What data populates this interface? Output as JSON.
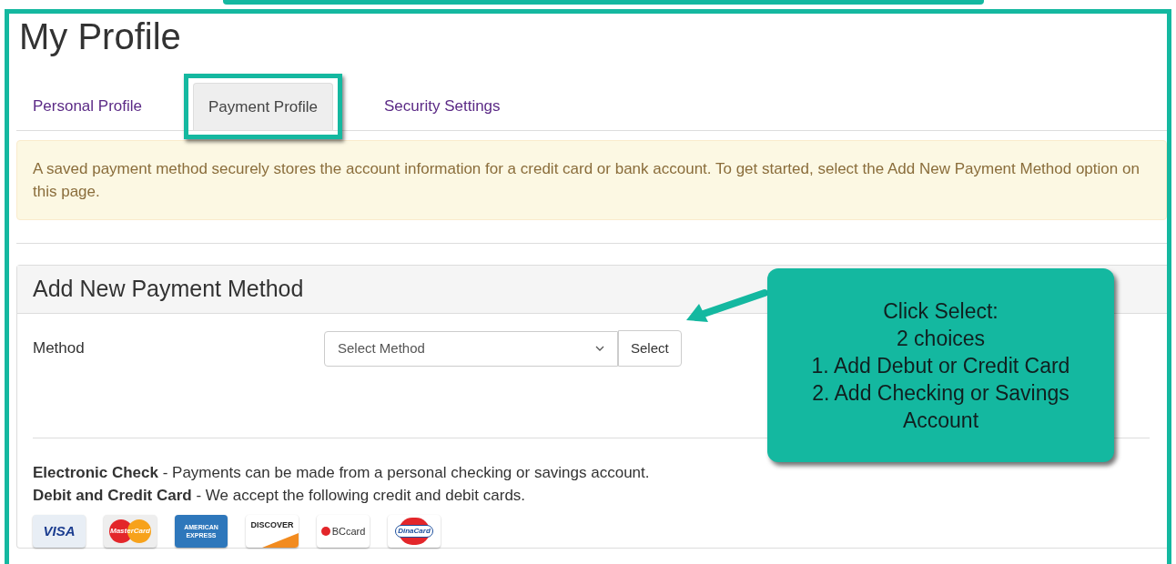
{
  "page": {
    "title": "My Profile"
  },
  "tabs": [
    {
      "label": "Personal Profile",
      "selected": false,
      "highlighted": false
    },
    {
      "label": "Payment Profile",
      "selected": true,
      "highlighted": true
    },
    {
      "label": "Security Settings",
      "selected": false,
      "highlighted": false
    }
  ],
  "alert": "A saved payment method securely stores the account information for a credit card or bank account. To get started, select the Add New Payment Method option on this page.",
  "panel": {
    "title": "Add New Payment Method",
    "method_label": "Method",
    "select": {
      "value": "Select Method"
    },
    "button": "Select",
    "notes": [
      "**Electronic Check** - Payments can be made from a personal checking or savings account.",
      "**Debit and Credit Card** - We accept the following credit and debit cards."
    ],
    "cards": [
      {
        "kind": "visa",
        "label": "VISA"
      },
      {
        "kind": "mastercard",
        "label": "MasterCard"
      },
      {
        "kind": "amex",
        "label": "AMERICAN EXPRESS"
      },
      {
        "kind": "discover",
        "label": "DISCOVER"
      },
      {
        "kind": "bccard",
        "label": "BCcard"
      },
      {
        "kind": "dinacard",
        "label": "DinaCard"
      }
    ]
  },
  "callout": {
    "lines": [
      "Click Select:",
      "2 choices",
      "1. Add Debut or Credit Card",
      "2. Add Checking or Savings Account"
    ]
  }
}
